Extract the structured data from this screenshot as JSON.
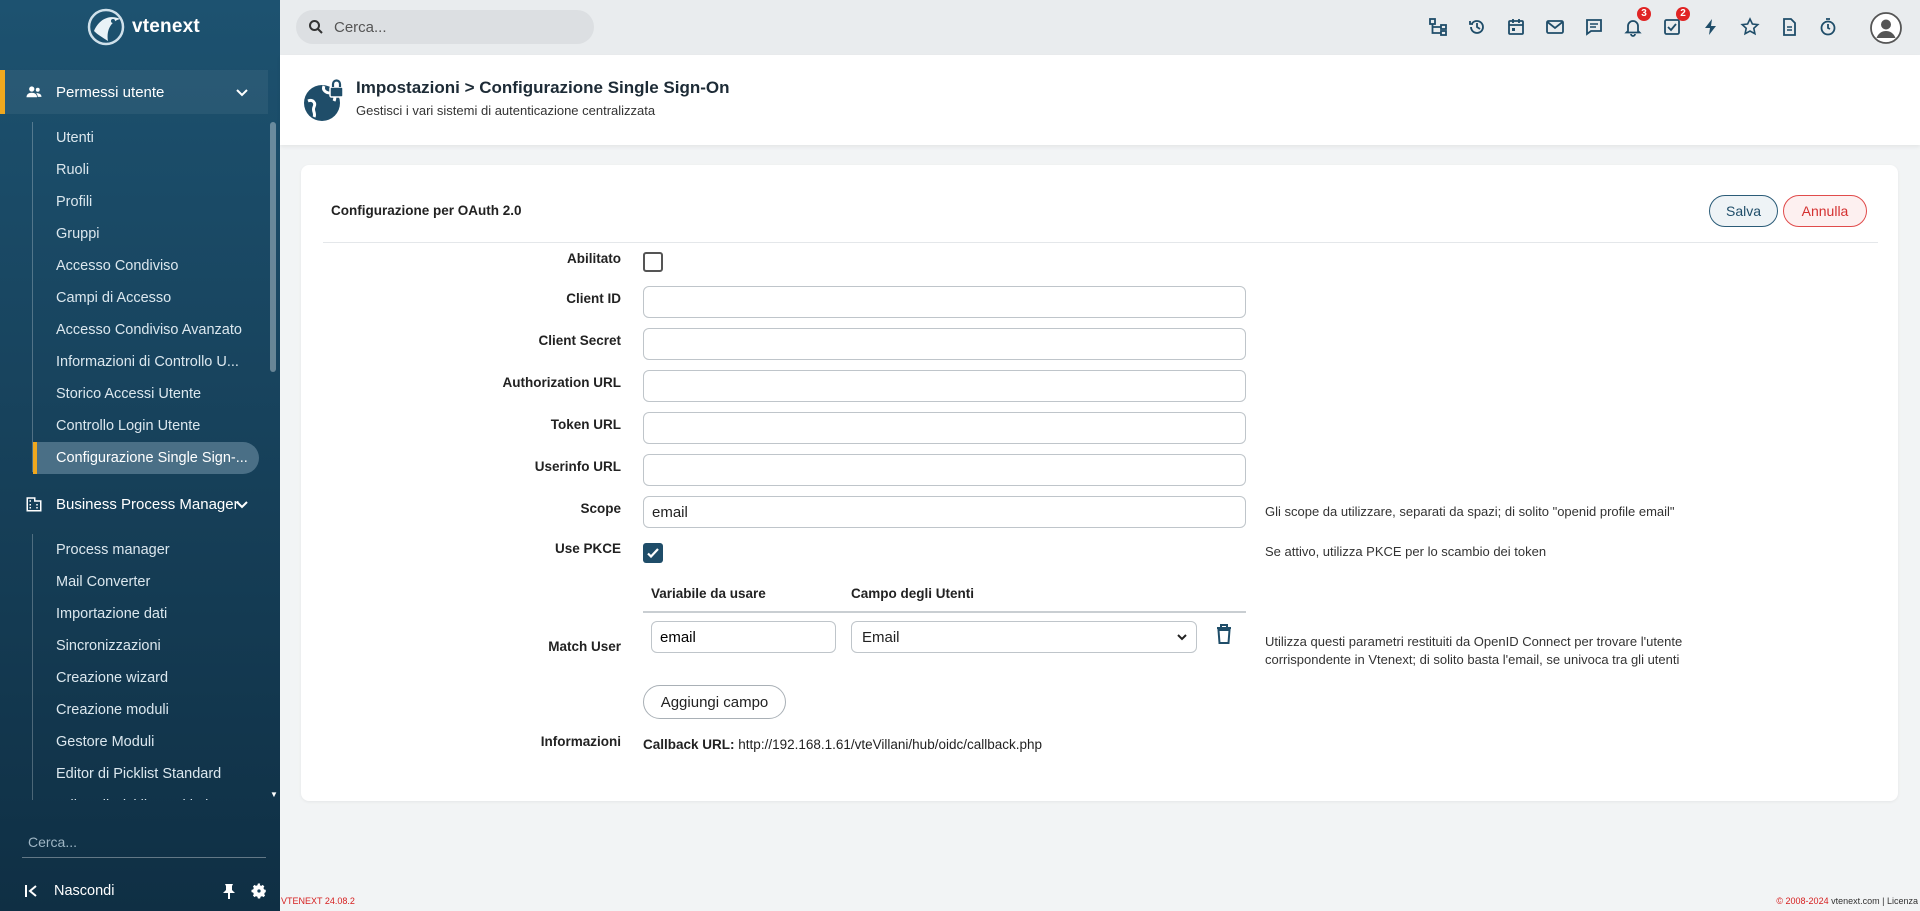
{
  "app": {
    "logo_text": "vtenext",
    "version": "VTENEXT 24.08.2",
    "copyright": "© 2008-2024",
    "copyright_site": "vtenext.com",
    "license_link": "Licenza"
  },
  "sidebar": {
    "sections": [
      {
        "label": "Permessi utente",
        "icon": "users-icon",
        "expanded": true,
        "items": [
          "Utenti",
          "Ruoli",
          "Profili",
          "Gruppi",
          "Accesso Condiviso",
          "Campi di Accesso",
          "Accesso Condiviso Avanzato",
          "Informazioni di Controllo U...",
          "Storico Accessi Utente",
          "Controllo Login Utente",
          "Configurazione Single Sign-..."
        ],
        "active_index": 10
      },
      {
        "label": "Business Process Manager",
        "icon": "building-icon",
        "expanded": true,
        "items": [
          "Process manager",
          "Mail Converter",
          "Importazione dati",
          "Sincronizzazioni",
          "Creazione wizard",
          "Creazione moduli",
          "Gestore Moduli",
          "Editor di Picklist Standard",
          "Editor di Picklist Multi Li..."
        ]
      }
    ],
    "search_placeholder": "Cerca...",
    "hide_label": "Nascondi"
  },
  "topbar": {
    "search_placeholder": "Cerca...",
    "icons": [
      {
        "name": "hierarchy-icon"
      },
      {
        "name": "history-icon"
      },
      {
        "name": "calendar-icon"
      },
      {
        "name": "mail-icon"
      },
      {
        "name": "chat-icon"
      },
      {
        "name": "bell-icon",
        "badge": "3"
      },
      {
        "name": "tasks-icon",
        "badge": "2"
      },
      {
        "name": "lightning-icon"
      },
      {
        "name": "star-icon"
      },
      {
        "name": "document-icon"
      },
      {
        "name": "timer-icon"
      }
    ]
  },
  "header": {
    "title": "Impostazioni > Configurazione Single Sign-On",
    "subtitle": "Gestisci i vari sistemi di autenticazione centralizzata"
  },
  "card": {
    "title": "Configurazione per OAuth 2.0",
    "save_label": "Salva",
    "cancel_label": "Annulla",
    "fields": {
      "abilitato": {
        "label": "Abilitato",
        "checked": false
      },
      "client_id": {
        "label": "Client ID",
        "value": ""
      },
      "client_secret": {
        "label": "Client Secret",
        "value": ""
      },
      "authorization_url": {
        "label": "Authorization URL",
        "value": ""
      },
      "token_url": {
        "label": "Token URL",
        "value": ""
      },
      "userinfo_url": {
        "label": "Userinfo URL",
        "value": ""
      },
      "scope": {
        "label": "Scope",
        "value": "email",
        "hint": "Gli scope da utilizzare, separati da spazi; di solito \"openid profile email\""
      },
      "use_pkce": {
        "label": "Use PKCE",
        "checked": true,
        "hint": "Se attivo, utilizza PKCE per lo scambio dei token"
      }
    },
    "match_user": {
      "label": "Match User",
      "col_var": "Variabile da usare",
      "col_field": "Campo degli Utenti",
      "var_value": "email",
      "field_value": "Email",
      "hint_line1": "Utilizza questi parametri restituiti da OpenID Connect per trovare l'utente",
      "hint_line2": "corrispondente in Vtenext; di solito basta l'email, se univoca tra gli utenti",
      "add_label": "Aggiungi campo"
    },
    "info": {
      "label": "Informazioni",
      "callback_label": "Callback URL:",
      "callback_value": "http://192.168.1.61/vteVillani/hub/oidc/callback.php"
    }
  }
}
